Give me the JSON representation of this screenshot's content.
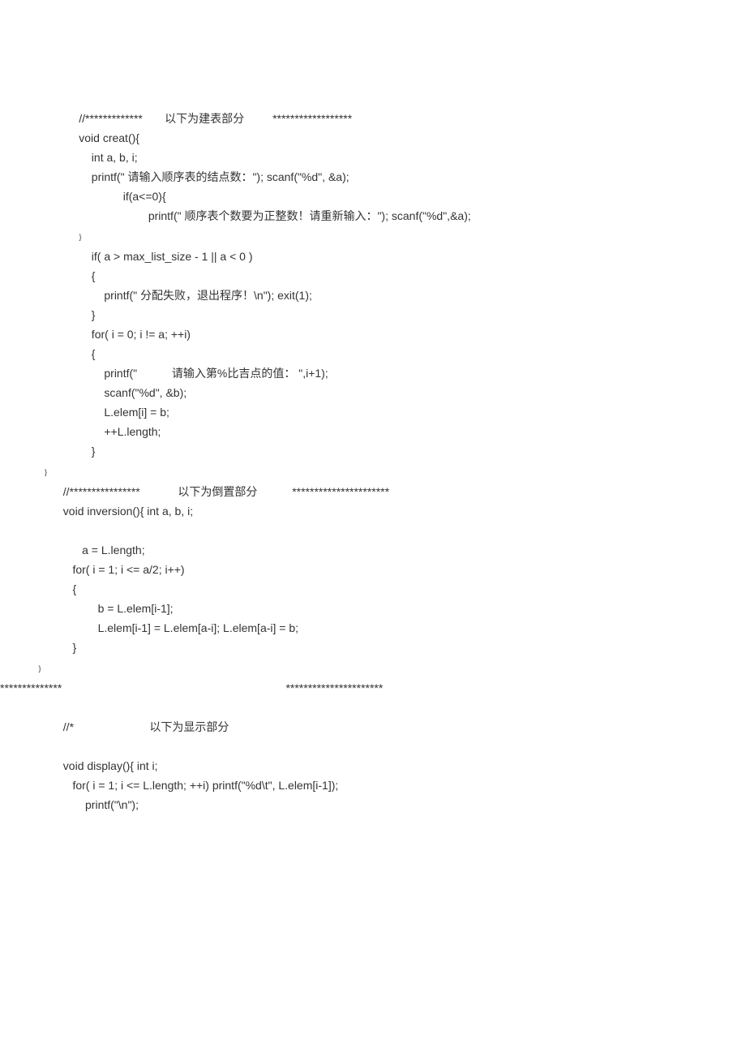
{
  "lines": {
    "l01": "//*************       以下为建表部分         ******************",
    "l02": "void creat(){",
    "l03": "    int a, b, i;",
    "l04": "    printf(\" 请输入顺序表的结点数：\"); scanf(\"%d\", &a);",
    "l05": "              if(a<=0){",
    "l06": "                      printf(\" 顺序表个数要为正整数！请重新输入：\"); scanf(\"%d\",&a);",
    "l07": "              }",
    "l08": "    if( a > max_list_size - 1 || a < 0 )",
    "l09": "    {",
    "l10": "        printf(\" 分配失败，退出程序！\\n\"); exit(1);",
    "l11": "    }",
    "l12": "    for( i = 0; i != a; ++i)",
    "l13": "    {",
    "l14": "        printf(\"           请输入第%比吉点的值： \",i+1);",
    "l15": "        scanf(\"%d\", &b);",
    "l16": "        L.elem[i] = b;",
    "l17": "        ++L.length;",
    "l18": "    }",
    "l19": "}",
    "l20": "//****************            以下为倒置部分           **********************",
    "l21": "void inversion(){ int a, b, i;",
    "l22": "",
    "l23": "      a = L.length;",
    "l24": "   for( i = 1; i <= a/2; i++)",
    "l25": "   {",
    "l26": "           b = L.elem[i-1];",
    "l27": "           L.elem[i-1] = L.elem[a-i]; L.elem[a-i] = b;",
    "l28": "   }",
    "l29": "}",
    "l30a": "**************",
    "l30b": "**********************",
    "l31": "//*                        以下为显示部分",
    "l32": "",
    "l33": "void display(){ int i;",
    "l34": "   for( i = 1; i <= L.length; ++i) printf(\"%d\\t\", L.elem[i-1]);",
    "l35": "       printf(\"\\n\");"
  }
}
